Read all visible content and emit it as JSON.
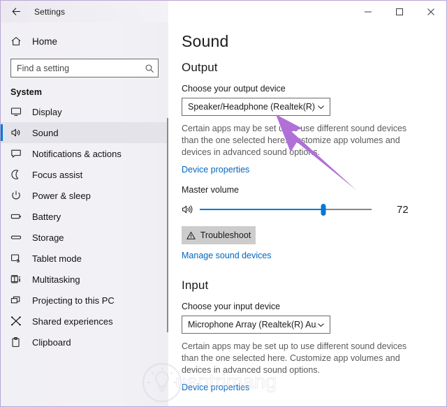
{
  "window": {
    "app_title": "Settings",
    "back_icon": "back-arrow-icon",
    "minimize_label": "–",
    "maximize_label": "□",
    "close_label": "✕",
    "border_color": "#b9a7d4"
  },
  "sidebar": {
    "home": {
      "label": "Home",
      "icon": "home-icon"
    },
    "search": {
      "value": "",
      "placeholder": "Find a setting",
      "icon": "search-icon"
    },
    "group_title": "System",
    "selected": "Sound",
    "accent_color": "#0078d7",
    "items": [
      {
        "label": "Display",
        "icon": "monitor-icon"
      },
      {
        "label": "Sound",
        "icon": "speaker-icon"
      },
      {
        "label": "Notifications & actions",
        "icon": "notification-icon"
      },
      {
        "label": "Focus assist",
        "icon": "moon-icon"
      },
      {
        "label": "Power & sleep",
        "icon": "power-icon"
      },
      {
        "label": "Battery",
        "icon": "battery-icon"
      },
      {
        "label": "Storage",
        "icon": "storage-icon"
      },
      {
        "label": "Tablet mode",
        "icon": "tablet-icon"
      },
      {
        "label": "Multitasking",
        "icon": "multitasking-icon"
      },
      {
        "label": "Projecting to this PC",
        "icon": "projecting-icon"
      },
      {
        "label": "Shared experiences",
        "icon": "shared-icon"
      },
      {
        "label": "Clipboard",
        "icon": "clipboard-icon"
      }
    ]
  },
  "main": {
    "page_title": "Sound",
    "output": {
      "heading": "Output",
      "device_label": "Choose your output device",
      "device_value": "Speaker/Headphone (Realtek(R) A...",
      "helper_text": "Certain apps may be set up to use different sound devices than the one selected here. Customize app volumes and devices in advanced sound options.",
      "device_properties_link": "Device properties",
      "volume_label": "Master volume",
      "volume_value": "72",
      "volume_percent": 72,
      "volume_icon": "speaker-wave-icon",
      "troubleshoot_label": "Troubleshoot",
      "troubleshoot_icon": "warning-triangle-icon",
      "manage_devices_link": "Manage sound devices"
    },
    "input": {
      "heading": "Input",
      "device_label": "Choose your input device",
      "device_value": "Microphone Array (Realtek(R) Au...",
      "helper_text": "Certain apps may be set up to use different sound devices than the one selected here. Customize app volumes and devices in advanced sound options.",
      "device_properties_link": "Device properties"
    }
  },
  "overlay": {
    "cursor_icon": "arrow-pointer-icon",
    "cursor_color": "#b070d8",
    "watermark_text": "uantrimang",
    "watermark_icon": "lightbulb-icon"
  }
}
